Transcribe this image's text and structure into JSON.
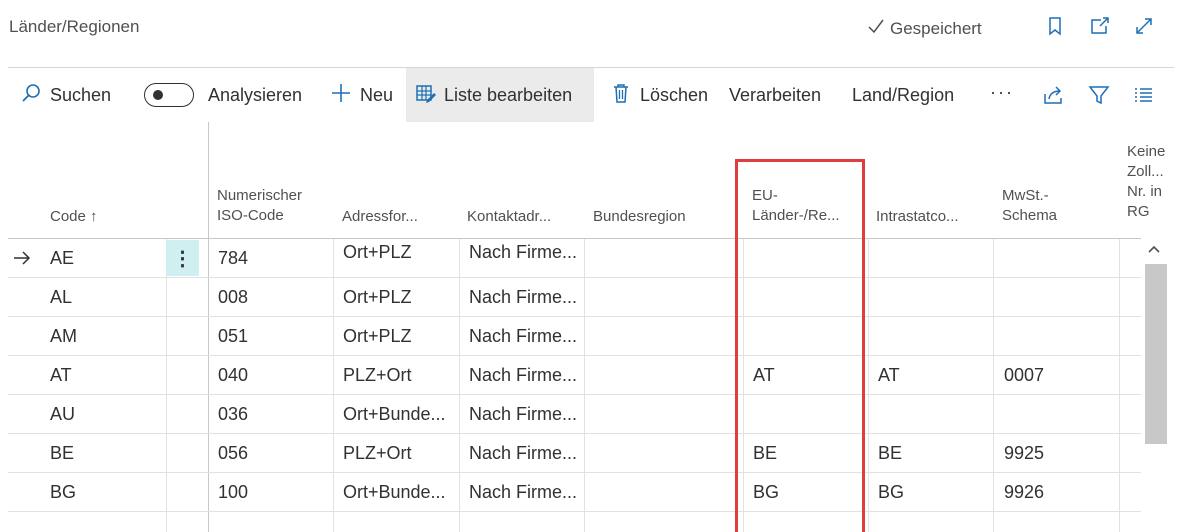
{
  "header": {
    "title": "Länder/Regionen",
    "saved_label": "Gespeichert"
  },
  "toolbar": {
    "search_label": "Suchen",
    "analyze_label": "Analysieren",
    "new_label": "Neu",
    "edit_list_label": "Liste bearbeiten",
    "delete_label": "Löschen",
    "process_label": "Verarbeiten",
    "country_region_label": "Land/Region",
    "more_label": "···"
  },
  "table": {
    "columns": {
      "code": "Code ↑",
      "iso_line1": "Numerischer",
      "iso_line2": "ISO-Code",
      "address_format": "Adressfor...",
      "contact_address": "Kontaktadr...",
      "federal_region": "Bundesregion",
      "eu_line1": "EU-",
      "eu_line2": "Länder-/Re...",
      "intrastat": "Intrastatco...",
      "vat_line1": "MwSt.-",
      "vat_line2": "Schema",
      "customs_line1": "Keine",
      "customs_line2": "Zoll...",
      "customs_line3": "Nr. in",
      "customs_line4": "RG"
    },
    "rows": [
      {
        "code": "AE",
        "iso": "784",
        "address_format": "Ort+PLZ",
        "contact": "Nach Firme...",
        "federal": "",
        "eu": "",
        "intrastat": "",
        "vat": ""
      },
      {
        "code": "AL",
        "iso": "008",
        "address_format": "Ort+PLZ",
        "contact": "Nach Firme...",
        "federal": "",
        "eu": "",
        "intrastat": "",
        "vat": ""
      },
      {
        "code": "AM",
        "iso": "051",
        "address_format": "Ort+PLZ",
        "contact": "Nach Firme...",
        "federal": "",
        "eu": "",
        "intrastat": "",
        "vat": ""
      },
      {
        "code": "AT",
        "iso": "040",
        "address_format": "PLZ+Ort",
        "contact": "Nach Firme...",
        "federal": "",
        "eu": "AT",
        "intrastat": "AT",
        "vat": "0007"
      },
      {
        "code": "AU",
        "iso": "036",
        "address_format": "Ort+Bunde...",
        "contact": "Nach Firme...",
        "federal": "",
        "eu": "",
        "intrastat": "",
        "vat": ""
      },
      {
        "code": "BE",
        "iso": "056",
        "address_format": "PLZ+Ort",
        "contact": "Nach Firme...",
        "federal": "",
        "eu": "BE",
        "intrastat": "BE",
        "vat": "9925"
      },
      {
        "code": "BG",
        "iso": "100",
        "address_format": "Ort+Bunde...",
        "contact": "Nach Firme...",
        "federal": "",
        "eu": "BG",
        "intrastat": "BG",
        "vat": "9926"
      }
    ],
    "row_menu_label": "⋮"
  },
  "colors": {
    "highlight_border": "#e23d3d",
    "row_menu_bg": "#cfeff0",
    "active_toolbar_bg": "#ebebeb",
    "icon_color": "#1f6fb5"
  }
}
